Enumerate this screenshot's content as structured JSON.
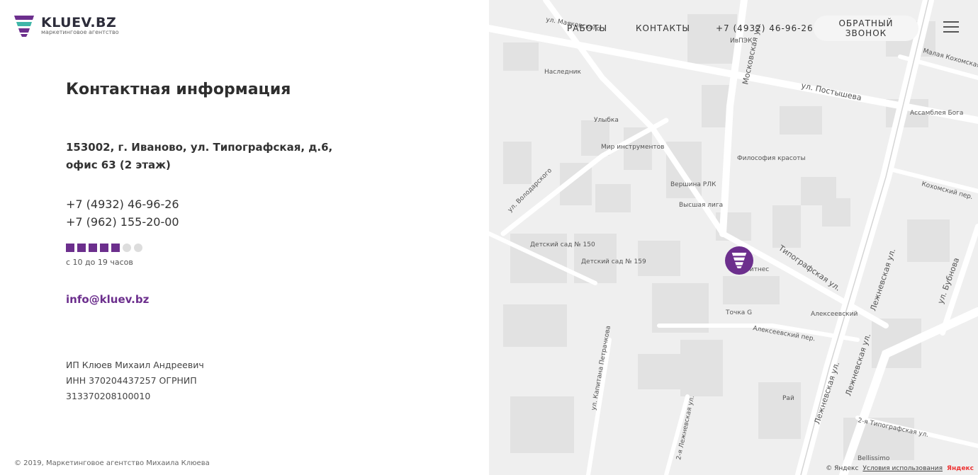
{
  "logo": {
    "name": "KLUEV.BZ",
    "subtitle": "маркетинговое агентство"
  },
  "nav": {
    "works": "РАБОТЫ",
    "contacts": "КОНТАКТЫ",
    "phone": "+7 (4932) 46-96-26",
    "callback": "ОБРАТНЫЙ ЗВОНОК"
  },
  "contacts": {
    "title": "Контактная информация",
    "address_line1": "153002, г. Иваново, ул. Типографская, д.6,",
    "address_line2": "офис 63 (2 этаж)",
    "phone1": "+7 (4932) 46-96-26",
    "phone2": "+7 (962) 155-20-00",
    "workdays": {
      "active": 5,
      "total": 7
    },
    "hours": "с 10 до 19 часов",
    "email": "info@kluev.bz",
    "legal_line1": "ИП Клюев Михаил Андреевич",
    "legal_line2": "ИНН 370204437257 ОГРНИП",
    "legal_line3": "313370208100010"
  },
  "footer": {
    "copyright": "© 2019, Маркетинговое агентство Михаила Клюева"
  },
  "map": {
    "labels": {
      "l1": "ул. Маяковского",
      "l2": "ул. Постышева",
      "l3": "Московская ул.",
      "l4": "Ассамблея Бога",
      "l5": "Улыбка",
      "l6": "Мир инструментов",
      "l7": "Философия красоты",
      "l8": "Вершина РЛК",
      "l9": "Высшая лига",
      "l10": "ул. Володарского",
      "l11": "Детский сад № 150",
      "l12": "Детский сад № 159",
      "l13": "Типографская ул.",
      "l14": "Точка G",
      "l15": "Алексеевский",
      "l16": "Алексеевский пер.",
      "l17": "Лежневская ул.",
      "l18": "ул. Бубнова",
      "l19": "Кохомский пер.",
      "l20": "Малая Кохомская ул.",
      "l21": "ул. Капитана Петрачкова",
      "l22": "2-я Лежневская ул.",
      "l23": "2-я Типографская ул.",
      "l24": "Bellissimo",
      "l25": "Рай",
      "l26": "Наследник",
      "l27": "ИвПЭК",
      "l28": "Лежневская ул.",
      "l29": "Лежневская ул.",
      "l30": "Фитнес"
    },
    "footer_brand": "© Яндекс",
    "footer_terms": "Условия использования",
    "footer_logo": "Яндекс"
  },
  "colors": {
    "accent": "#6c2f8d",
    "teal": "#3fb6a8"
  },
  "icons": {
    "marker": "kluev-logo-icon",
    "menu": "burger-icon"
  }
}
